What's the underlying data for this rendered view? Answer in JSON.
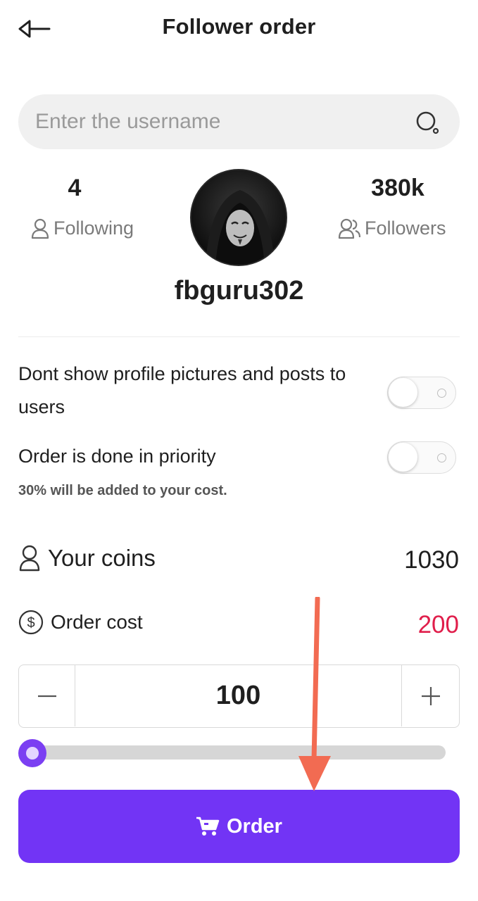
{
  "header": {
    "title": "Follower order",
    "back_icon": "back-arrow-icon"
  },
  "search": {
    "placeholder": "Enter the username",
    "value": "",
    "icon": "search-icon"
  },
  "profile": {
    "following_count": "4",
    "following_label": "Following",
    "followers_count": "380k",
    "followers_label": "Followers",
    "username": "fbguru302"
  },
  "options": [
    {
      "label": "Dont show profile pictures and posts to users",
      "enabled": false
    },
    {
      "label": "Order is done in priority",
      "note": "30% will be added to your cost.",
      "enabled": false
    }
  ],
  "coins": {
    "label": "Your coins",
    "value": "1030"
  },
  "cost": {
    "label": "Order cost",
    "value": "200",
    "color": "#e01e4b"
  },
  "quantity": {
    "value": "100",
    "minus": "−",
    "plus": "+"
  },
  "slider": {
    "level": 0
  },
  "order_button": {
    "label": "Order",
    "color": "#7234f5"
  },
  "annotation": {
    "arrow_color": "#f26b52"
  }
}
